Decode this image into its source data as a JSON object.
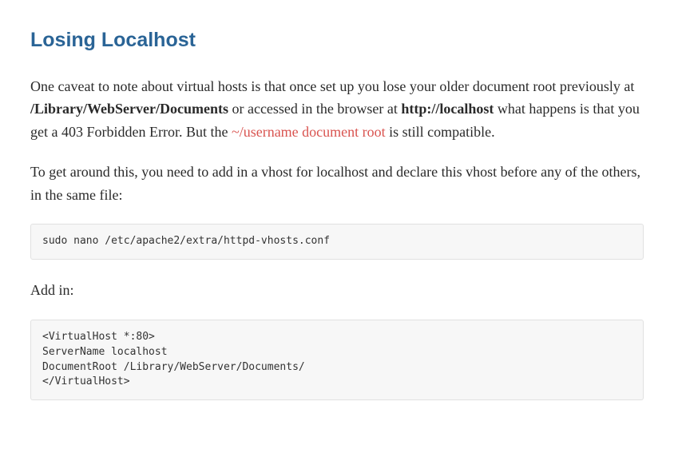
{
  "heading": "Losing Localhost",
  "para1": {
    "part1": "One caveat to note about virtual hosts is that once set up you lose your older document root previously at ",
    "bold1": "/Library/WebServer/Documents",
    "part2": " or accessed in the browser at ",
    "bold2": "http://localhost",
    "part3": " what happens is that you get a 403 Forbidden Error. But the ",
    "link_text": "~/username document root",
    "part4": " is still compatible."
  },
  "para2": "To get around this, you need to add in a vhost for localhost and declare this vhost before any of the others, in the same file:",
  "code1": "sudo nano /etc/apache2/extra/httpd-vhosts.conf",
  "add_in": "Add in:",
  "code2": "<VirtualHost *:80>\nServerName localhost\nDocumentRoot /Library/WebServer/Documents/\n</VirtualHost>"
}
